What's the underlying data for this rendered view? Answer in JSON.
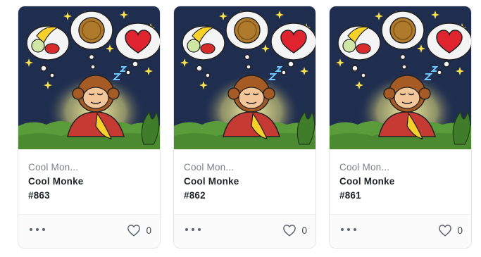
{
  "cards": [
    {
      "collection": "Cool Mon...",
      "name": "Cool Monke",
      "number": "#863",
      "likes": "0",
      "art_icon": "monkey-dreaming-art"
    },
    {
      "collection": "Cool Mon...",
      "name": "Cool Monke",
      "number": "#862",
      "likes": "0",
      "art_icon": "monkey-dreaming-art"
    },
    {
      "collection": "Cool Mon...",
      "name": "Cool Monke",
      "number": "#861",
      "likes": "0",
      "art_icon": "monkey-dreaming-art"
    }
  ],
  "colors": {
    "sky": "#1f2d4f",
    "grass": "#5a9b3a",
    "star": "#ffe34d",
    "heart": "#e0242f",
    "text_muted": "#7a7f87",
    "text_main": "#1f2328",
    "card_border": "#e3e5e8"
  },
  "icons": {
    "more": "more-dots-icon",
    "like": "heart-outline-icon"
  }
}
